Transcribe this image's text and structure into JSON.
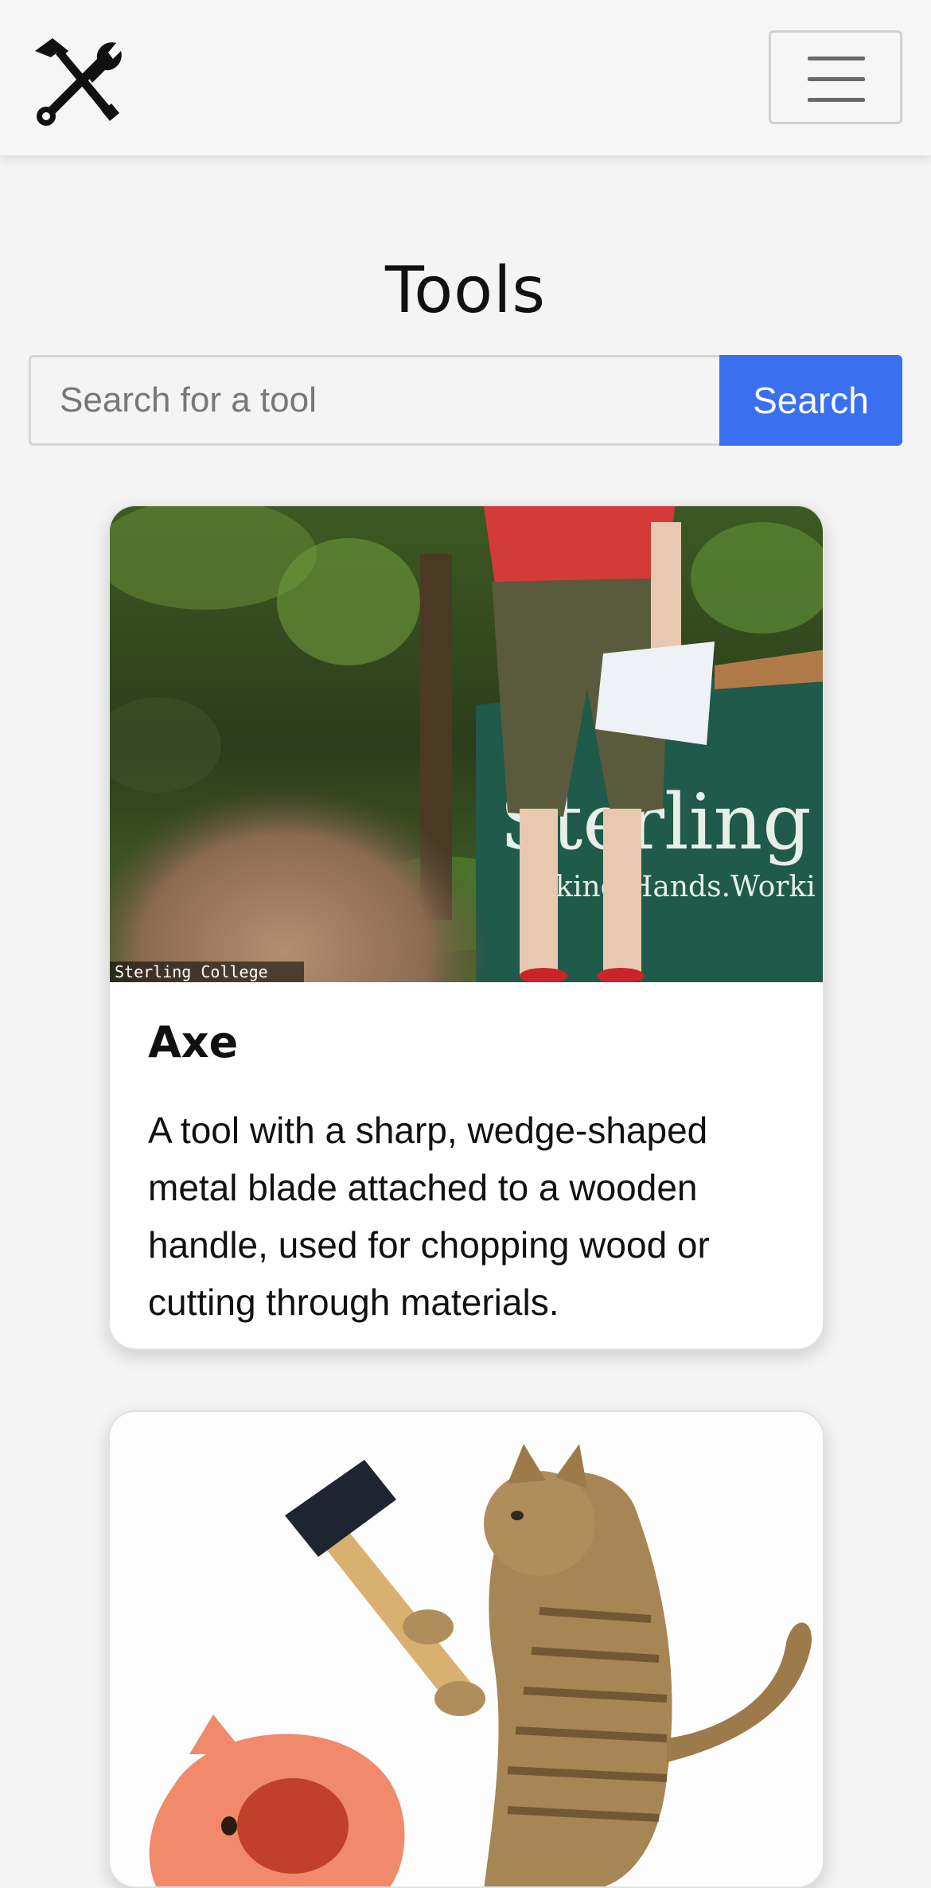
{
  "navbar": {
    "logo_icon": "hammer-wrench-icon",
    "menu_icon": "hamburger-menu-icon"
  },
  "main": {
    "title": "Tools",
    "search": {
      "placeholder": "Search for a tool",
      "value": "",
      "button_label": "Search"
    }
  },
  "cards": [
    {
      "title": "Axe",
      "description": "A tool with a sharp, wedge-shaped metal blade attached to a wooden handle, used for chopping wood or cutting through materials.",
      "image_watermark": "Sterling College",
      "image_banner_text": "Sterling Co",
      "image_banner_subtext": "king Hands.Worki"
    },
    {
      "title": "",
      "description": ""
    }
  ],
  "colors": {
    "accent": "#3a6ff0",
    "background": "#f4f4f4",
    "card": "#ffffff"
  }
}
